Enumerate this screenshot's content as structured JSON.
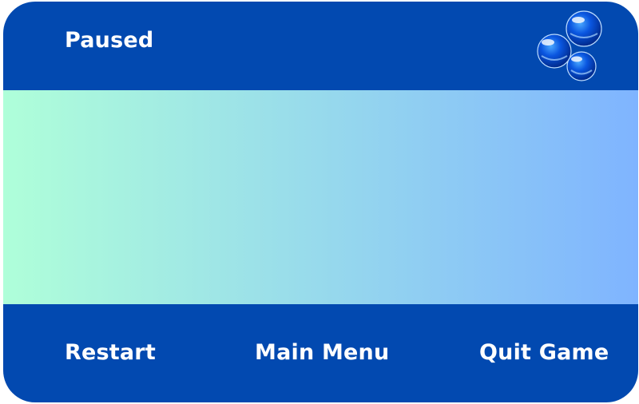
{
  "pause_menu": {
    "title": "Paused",
    "buttons": {
      "restart": "Restart",
      "main_menu": "Main Menu",
      "quit_game": "Quit Game"
    }
  },
  "colors": {
    "panel": "#0249b0",
    "gradient_start": "#afffd9",
    "gradient_end": "#7fb4ff"
  },
  "icons": [
    "bubbles-icon"
  ]
}
